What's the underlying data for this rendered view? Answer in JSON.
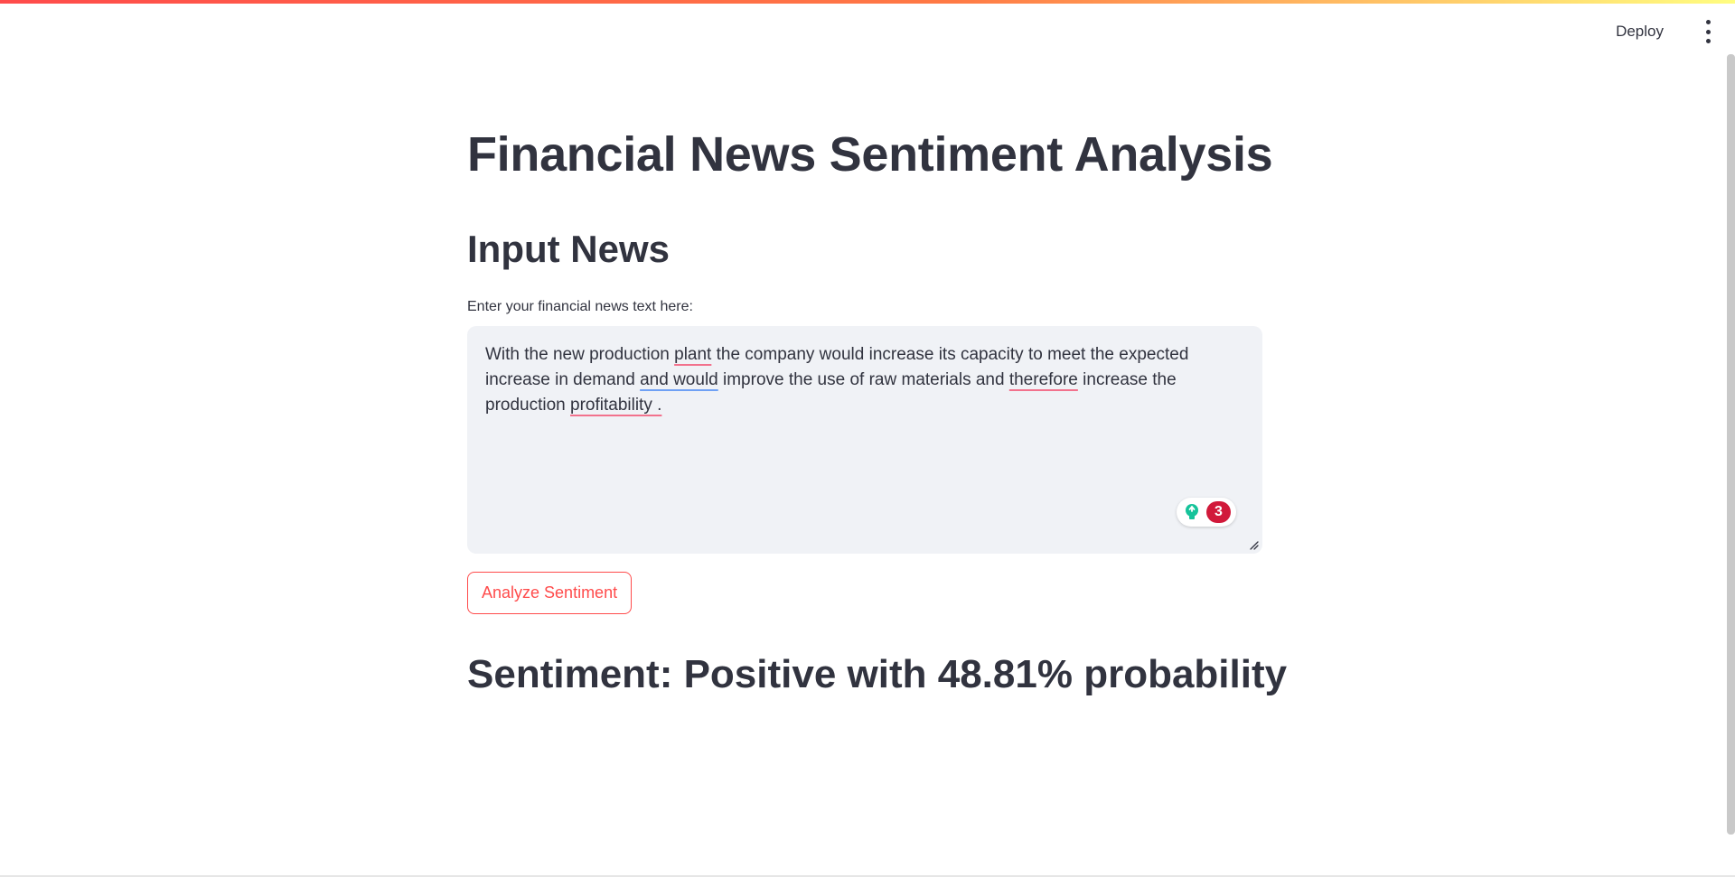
{
  "header": {
    "deploy_label": "Deploy",
    "accent_gradient": [
      "#ff4b4b",
      "#ff7a45",
      "#fffd80"
    ]
  },
  "main": {
    "title": "Financial News Sentiment Analysis",
    "subheader": "Input News",
    "input_label": "Enter your financial news text here:",
    "input_value": {
      "seg1": "With the new production ",
      "w_plant": "plant",
      "seg2": " the company would increase its capacity to meet the expected increase in demand ",
      "w_and_would": "and would",
      "seg3": " improve the use of raw materials and ",
      "w_therefore": "therefore",
      "seg4": " increase the production ",
      "w_profitability": "profitability .",
      "full_text": "With the new production plant the company would increase its capacity to meet the expected increase in demand and would improve the use of raw materials and therefore increase the production profitability ."
    },
    "grammarly": {
      "icon": "lightbulb-icon",
      "issue_count": "3"
    },
    "analyze_button": "Analyze Sentiment",
    "result_text": "Sentiment: Positive with 48.81% probability"
  },
  "colors": {
    "primary": "#ff4b4b",
    "text": "#31333F",
    "input_bg": "#f0f2f6",
    "grammarly_green": "#15c39a",
    "grammarly_red": "#d1193a"
  }
}
